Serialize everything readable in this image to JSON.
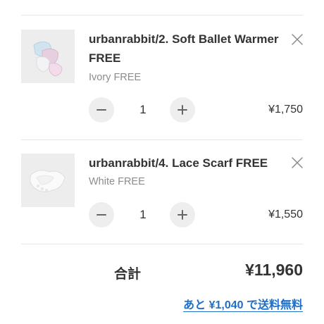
{
  "cart": {
    "items": [
      {
        "name": "urbanrabbit/2. Soft Ballet Warmer FREE",
        "variant": "Ivory FREE",
        "quantity": "1",
        "price": "¥1,750"
      },
      {
        "name": "urbanrabbit/4. Lace Scarf FREE",
        "variant": "White FREE",
        "quantity": "1",
        "price": "¥1,550"
      }
    ]
  },
  "summary": {
    "total_label": "合計",
    "total_value": "¥11,960",
    "free_shipping_link": "あと ¥1,040 で送料無料"
  },
  "icons": {
    "remove": "close-icon",
    "decrease": "minus-icon",
    "increase": "plus-icon"
  },
  "colors": {
    "link": "#1e6fc7",
    "button_bg": "#eeeeee",
    "divider": "#e6e6e6",
    "muted_text": "#8c8c8c"
  }
}
